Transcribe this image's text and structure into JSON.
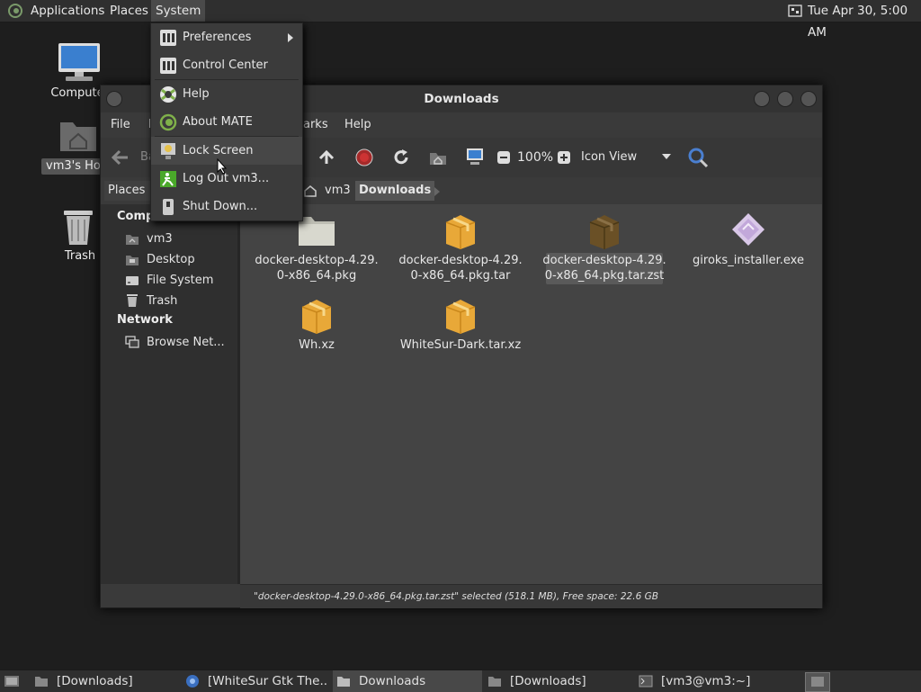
{
  "top_panel": {
    "menus": [
      "Applications",
      "Places",
      "System"
    ],
    "clock": "Tue Apr 30,  5:00 AM"
  },
  "desktop": {
    "icons": [
      {
        "label": "Compute",
        "icon": "computer-icon"
      },
      {
        "label": "vm3's Hor",
        "icon": "home-folder-icon"
      },
      {
        "label": "Trash",
        "icon": "trash-icon"
      }
    ]
  },
  "system_menu": {
    "items": [
      {
        "label": "Preferences",
        "icon": "preferences-icon",
        "submenu": true
      },
      {
        "label": "Control Center",
        "icon": "control-center-icon"
      },
      {
        "label": "Help",
        "icon": "help-icon"
      },
      {
        "label": "About MATE",
        "icon": "mate-logo-icon"
      },
      {
        "label": "Lock Screen",
        "icon": "lock-screen-icon"
      },
      {
        "label": "Log Out vm3...",
        "icon": "logout-icon"
      },
      {
        "label": "Shut Down...",
        "icon": "shutdown-icon"
      }
    ]
  },
  "window": {
    "title": "Downloads",
    "menubar": [
      "File",
      "E",
      "arks",
      "Help"
    ],
    "toolbar": {
      "back_label": "Ba",
      "zoom": "100%",
      "view_mode": "Icon View"
    },
    "location": {
      "places_label": "Places",
      "path": [
        "vm3",
        "Downloads"
      ]
    },
    "sidebar": {
      "computer_heading": "Computer",
      "computer_items": [
        "vm3",
        "Desktop",
        "File System",
        "Trash"
      ],
      "network_heading": "Network",
      "network_items": [
        "Browse Net..."
      ]
    },
    "files": [
      {
        "line1": "docker-desktop-4.29.",
        "line2": "0-x86_64.pkg",
        "icon": "folder-icon",
        "selected": false
      },
      {
        "line1": "docker-desktop-4.29.",
        "line2": "0-x86_64.pkg.tar",
        "icon": "package-icon",
        "selected": false
      },
      {
        "line1": "docker-desktop-4.29.",
        "line2": "0-x86_64.pkg.tar.zst",
        "icon": "package-icon",
        "selected": true
      },
      {
        "line1": "giroks_installer.exe",
        "line2": "",
        "icon": "executable-icon",
        "selected": false
      },
      {
        "line1": "Wh.xz",
        "line2": "",
        "icon": "package-icon",
        "selected": false
      },
      {
        "line1": "WhiteSur-Dark.tar.xz",
        "line2": "",
        "icon": "package-icon",
        "selected": false
      }
    ],
    "status": "\"docker-desktop-4.29.0-x86_64.pkg.tar.zst\" selected (518.1 MB), Free space: 22.6 GB"
  },
  "taskbar": {
    "tasks": [
      "[Downloads]",
      "[WhiteSur Gtk The...",
      "Downloads",
      "[Downloads]",
      "[vm3@vm3:~]"
    ]
  }
}
